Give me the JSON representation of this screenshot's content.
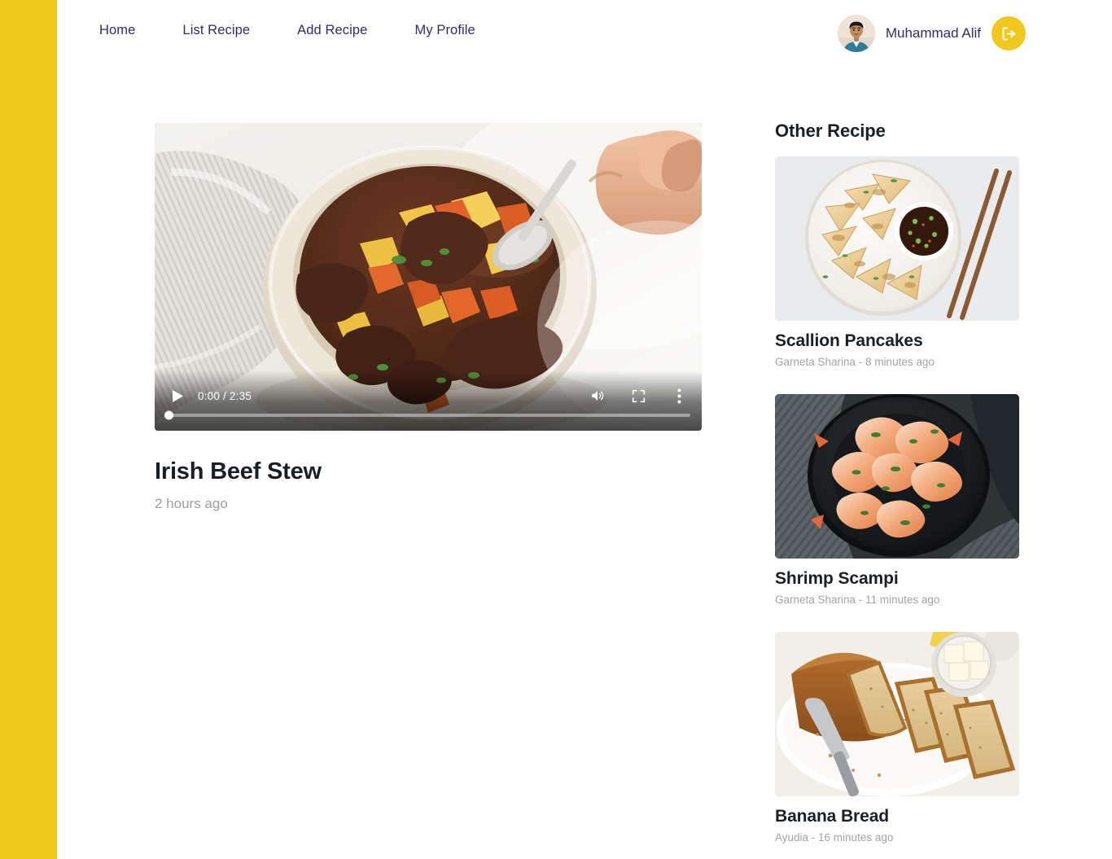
{
  "theme": {
    "rail_color": "#F0C81E",
    "accent_color": "#F0C81E",
    "nav_text_color": "#332a6b",
    "heading_color": "#1b1f23",
    "meta_color": "#a3a3a3"
  },
  "nav": {
    "items": [
      {
        "label": "Home"
      },
      {
        "label": "List Recipe"
      },
      {
        "label": "Add Recipe"
      },
      {
        "label": "My Profile"
      }
    ]
  },
  "user": {
    "name": "Muhammad Alif",
    "avatar_icon": "user-avatar-photo",
    "logout_icon": "logout-icon"
  },
  "video": {
    "poster_alt": "irish-beef-stew-bowl",
    "play_icon": "play-icon",
    "volume_icon": "volume-icon",
    "fullscreen_icon": "fullscreen-icon",
    "more_icon": "kebab-menu-icon",
    "time": "0:00 / 2:35",
    "current_time": "0:00",
    "duration": "2:35",
    "progress_percent": 0,
    "title": "Irish Beef Stew",
    "meta": "2 hours ago"
  },
  "sidebar": {
    "heading": "Other Recipe",
    "recipes": [
      {
        "title": "Scallion Pancakes",
        "meta": "Garneta Sharina - 8 minutes ago",
        "author": "Garneta Sharina",
        "time": "8 minutes ago",
        "thumb_alt": "scallion-pancakes-plate"
      },
      {
        "title": "Shrimp Scampi",
        "meta": "Garneta Sharina - 11 minutes ago",
        "author": "Garneta Sharina",
        "time": "11 minutes ago",
        "thumb_alt": "shrimp-scampi-black-plate"
      },
      {
        "title": "Banana Bread",
        "meta": "Ayudia - 16 minutes ago",
        "author": "Ayudia",
        "time": "16 minutes ago",
        "thumb_alt": "banana-bread-loaf-sliced"
      }
    ]
  }
}
